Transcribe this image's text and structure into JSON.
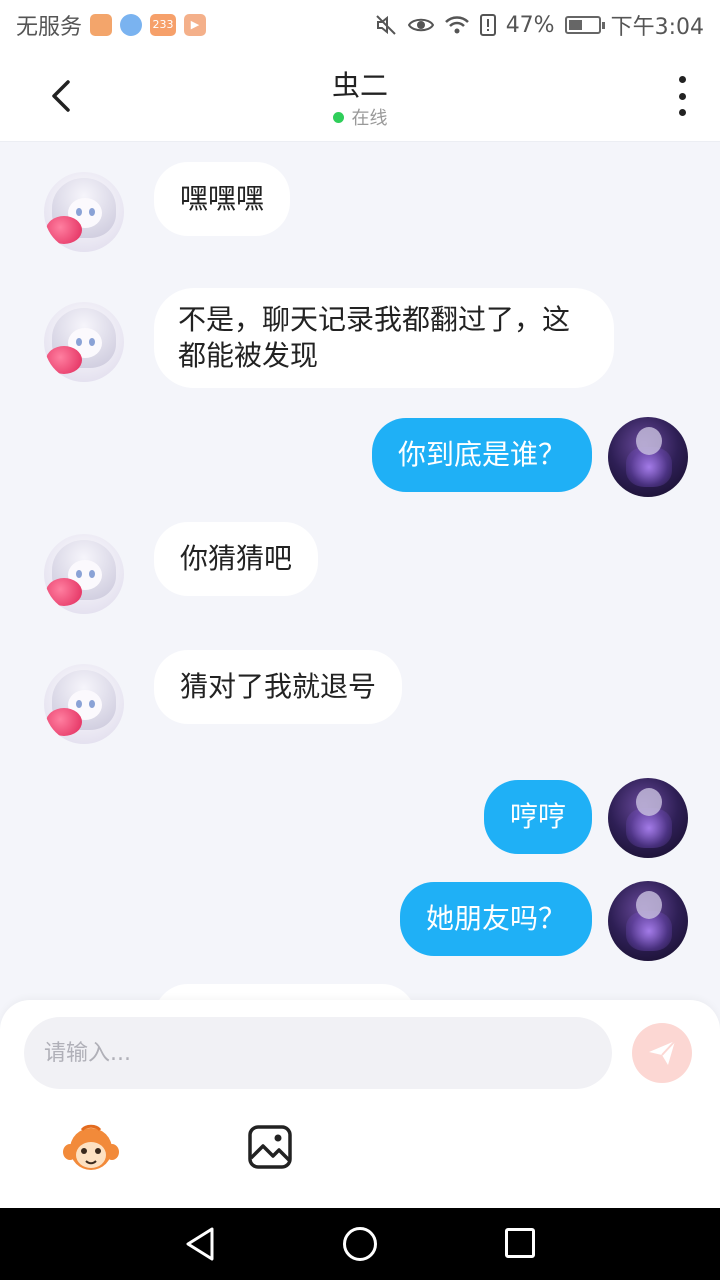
{
  "status_bar": {
    "carrier": "无服务",
    "app_icons": [
      "app-icon-1",
      "app-icon-2",
      "app-icon-233",
      "app-icon-play"
    ],
    "app_icon_233_label": "233",
    "battery_percent": "47%",
    "battery_level": 0.47,
    "time": "下午3:04"
  },
  "header": {
    "title": "虫二",
    "status": "在线"
  },
  "messages": [
    {
      "side": "in",
      "text": "嘿嘿嘿"
    },
    {
      "side": "in",
      "text": "不是，聊天记录我都翻过了，这都能被发现"
    },
    {
      "side": "out",
      "text": "你到底是谁？"
    },
    {
      "side": "in",
      "text": "你猜猜吧"
    },
    {
      "side": "in",
      "text": "猜对了我就退号"
    },
    {
      "side": "out",
      "text": "哼哼"
    },
    {
      "side": "out",
      "text": "她朋友吗？"
    }
  ],
  "input": {
    "placeholder": "请输入..."
  },
  "colors": {
    "outgoing_bubble": "#1fb0f6",
    "incoming_bubble": "#ffffff",
    "online_dot": "#2fce5a",
    "send_button": "#fcd7d3",
    "background": "#f4f5fa"
  },
  "icons": {
    "back": "chevron-left-icon",
    "more": "more-vertical-icon",
    "send": "paper-plane-icon",
    "emoji": "monkey-emoji-icon",
    "image": "image-icon",
    "nav_back": "triangle-back-icon",
    "nav_home": "circle-home-icon",
    "nav_recent": "square-recent-icon"
  }
}
